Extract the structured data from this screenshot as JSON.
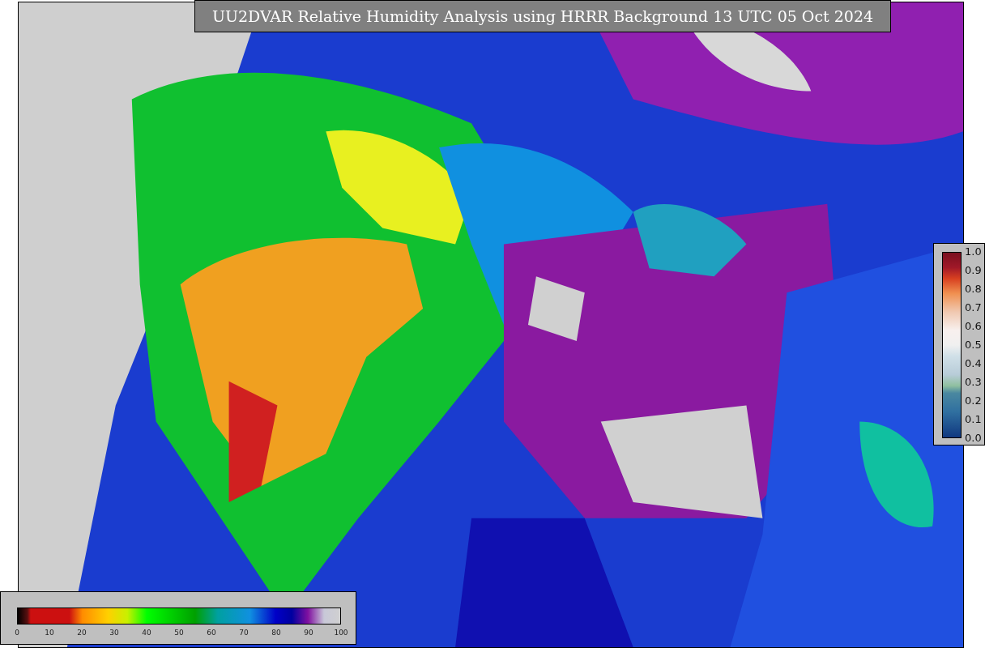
{
  "title": "UU2DVAR Relative Humidity Analysis using HRRR Background 13 UTC 05 Oct 2024",
  "bottom_colorbar": {
    "ticks": [
      "0",
      "10",
      "20",
      "30",
      "40",
      "50",
      "60",
      "70",
      "80",
      "90",
      "100"
    ]
  },
  "right_colorbar": {
    "ticks": [
      "1.0",
      "0.9",
      "0.8",
      "0.7",
      "0.6",
      "0.5",
      "0.4",
      "0.3",
      "0.2",
      "0.1",
      "0.0"
    ]
  }
}
